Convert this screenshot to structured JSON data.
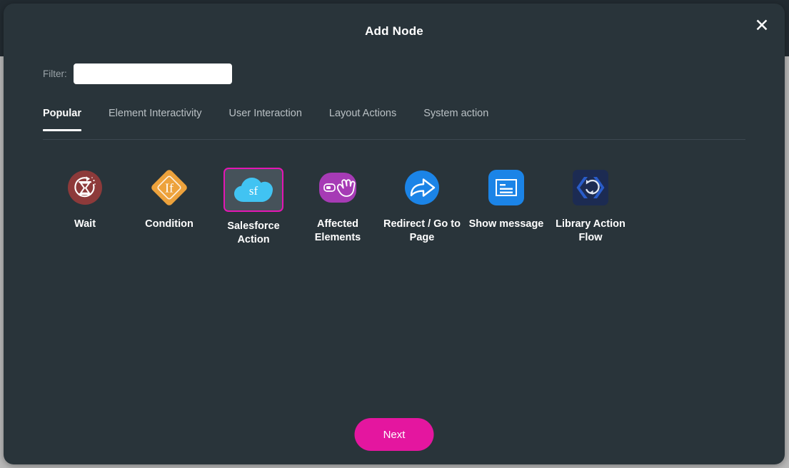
{
  "modal": {
    "title": "Add Node",
    "close_label": "✕"
  },
  "filter": {
    "label": "Filter:",
    "value": "",
    "placeholder": ""
  },
  "tabs": [
    {
      "label": "Popular",
      "active": true
    },
    {
      "label": "Element Interactivity",
      "active": false
    },
    {
      "label": "User Interaction",
      "active": false
    },
    {
      "label": "Layout Actions",
      "active": false
    },
    {
      "label": "System action",
      "active": false
    }
  ],
  "nodes": [
    {
      "label": "Wait",
      "icon": "wait-hourglass-icon",
      "selected": false
    },
    {
      "label": "Condition",
      "icon": "condition-if-diamond-icon",
      "selected": false
    },
    {
      "label": "Salesforce Action",
      "icon": "salesforce-cloud-icon",
      "selected": true
    },
    {
      "label": "Affected Elements",
      "icon": "affected-elements-hand-icon",
      "selected": false
    },
    {
      "label": "Redirect / Go to Page",
      "icon": "redirect-arrow-icon",
      "selected": false
    },
    {
      "label": "Show message",
      "icon": "show-message-document-icon",
      "selected": false
    },
    {
      "label": "Library Action Flow",
      "icon": "library-action-flow-icon",
      "selected": false
    }
  ],
  "footer": {
    "next_label": "Next"
  },
  "colors": {
    "modal_background": "#29343a",
    "page_background": "#b9b9b9",
    "accent_magenta": "#e4169f",
    "selection_border": "#e316b4",
    "tab_active_text": "#ffffff",
    "tab_inactive_text": "#b9c0c4",
    "wait_icon": "#8d3a3a",
    "condition_icon": "#eda23c",
    "salesforce_icon": "#41c3f2",
    "affected_elements_icon": "#a63bb5",
    "redirect_icon": "#1b84e7",
    "show_message_icon": "#1b84e7",
    "library_icon": "#1c2b52"
  }
}
